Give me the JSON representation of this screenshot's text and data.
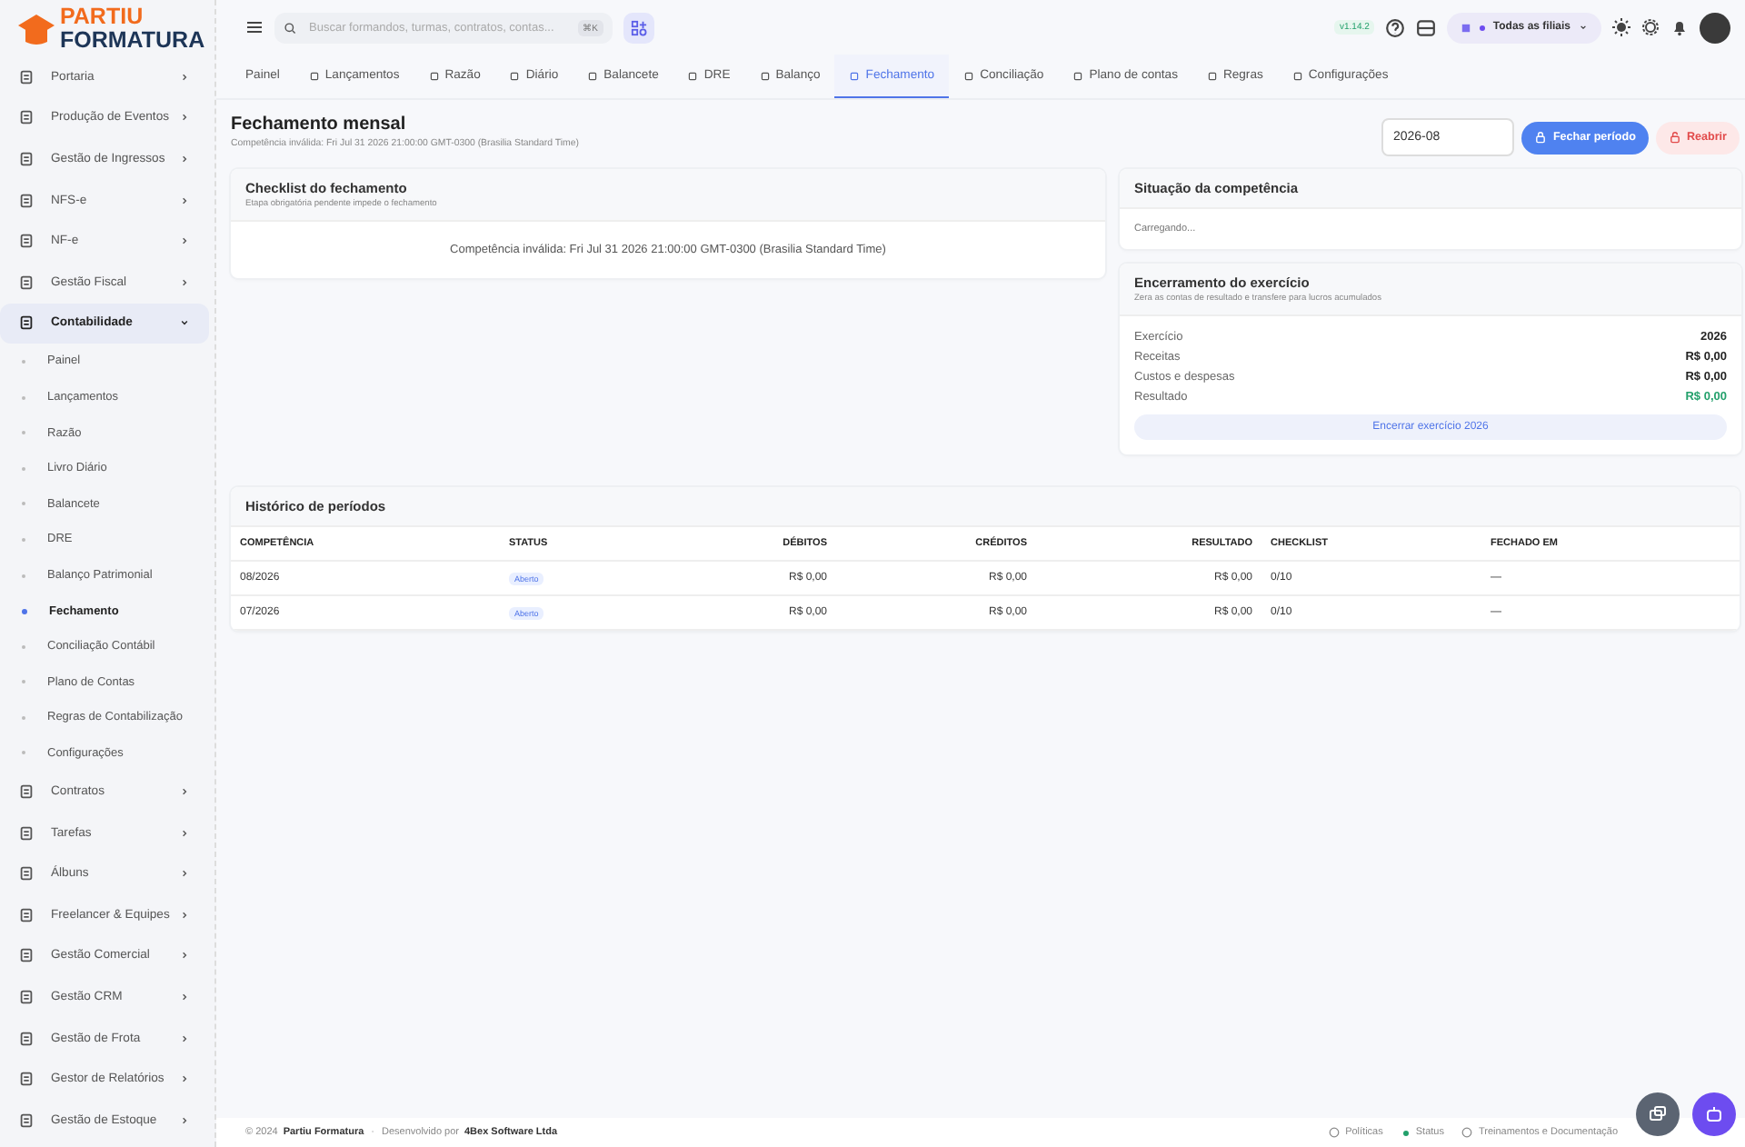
{
  "logo": {
    "line1": "PARTIU",
    "line2": "FORMATURA"
  },
  "sidebar": {
    "items": [
      {
        "label": "Portaria",
        "expanded": false,
        "selected": false
      },
      {
        "label": "Produção de Eventos",
        "expanded": false,
        "selected": false
      },
      {
        "label": "Gestão de Ingressos",
        "expanded": false,
        "selected": false
      },
      {
        "label": "NFS-e",
        "expanded": false,
        "selected": false
      },
      {
        "label": "NF-e",
        "expanded": false,
        "selected": false
      },
      {
        "label": "Gestão Fiscal",
        "expanded": false,
        "selected": false
      },
      {
        "label": "Contabilidade",
        "expanded": true,
        "selected": true,
        "children": [
          {
            "label": "Painel",
            "selected": false
          },
          {
            "label": "Lançamentos",
            "selected": false
          },
          {
            "label": "Razão",
            "selected": false
          },
          {
            "label": "Livro Diário",
            "selected": false
          },
          {
            "label": "Balancete",
            "selected": false
          },
          {
            "label": "DRE",
            "selected": false
          },
          {
            "label": "Balanço Patrimonial",
            "selected": false
          },
          {
            "label": "Fechamento",
            "selected": true
          },
          {
            "label": "Conciliação Contábil",
            "selected": false
          },
          {
            "label": "Plano de Contas",
            "selected": false
          },
          {
            "label": "Regras de Contabilização",
            "selected": false
          },
          {
            "label": "Configurações",
            "selected": false
          }
        ]
      },
      {
        "label": "Contratos",
        "expanded": false,
        "selected": false
      },
      {
        "label": "Tarefas",
        "expanded": false,
        "selected": false
      },
      {
        "label": "Álbuns",
        "expanded": false,
        "selected": false
      },
      {
        "label": "Freelancer & Equipes",
        "expanded": false,
        "selected": false
      },
      {
        "label": "Gestão Comercial",
        "expanded": false,
        "selected": false
      },
      {
        "label": "Gestão CRM",
        "expanded": false,
        "selected": false
      },
      {
        "label": "Gestão de Frota",
        "expanded": false,
        "selected": false
      },
      {
        "label": "Gestor de Relatórios",
        "expanded": false,
        "selected": false
      },
      {
        "label": "Gestão de Estoque",
        "expanded": false,
        "selected": false
      }
    ]
  },
  "topbar": {
    "search": {
      "placeholder": "Buscar formandos, turmas, contratos, contas...",
      "shortcut": "⌘K"
    },
    "version": "v1.14.2",
    "branch": "Todas as filiais"
  },
  "tabs": [
    {
      "label": "Painel",
      "selected": false
    },
    {
      "label": "Lançamentos",
      "selected": false
    },
    {
      "label": "Razão",
      "selected": false
    },
    {
      "label": "Diário",
      "selected": false
    },
    {
      "label": "Balancete",
      "selected": false
    },
    {
      "label": "DRE",
      "selected": false
    },
    {
      "label": "Balanço",
      "selected": false
    },
    {
      "label": "Fechamento",
      "selected": true
    },
    {
      "label": "Conciliação",
      "selected": false
    },
    {
      "label": "Plano de contas",
      "selected": false
    },
    {
      "label": "Regras",
      "selected": false
    },
    {
      "label": "Configurações",
      "selected": false
    }
  ],
  "page": {
    "title": "Fechamento mensal",
    "subtitle": "Competência inválida: Fri Jul 31 2026 21:00:00 GMT-0300 (Brasilia Standard Time)",
    "period": "2026-08",
    "close_button": "Fechar período",
    "reopen_button": "Reabrir"
  },
  "checklist": {
    "title": "Checklist do fechamento",
    "subtitle": "Etapa obrigatória pendente impede o fechamento",
    "message": "Competência inválida: Fri Jul 31 2026 21:00:00 GMT-0300 (Brasilia Standard Time)"
  },
  "situation": {
    "title": "Situação da competência",
    "message": "Carregando..."
  },
  "year_closing": {
    "title": "Encerramento do exercício",
    "subtitle": "Zera as contas de resultado e transfere para lucros acumulados",
    "rows": [
      {
        "label": "Exercício",
        "value": "2026",
        "kind": "plain"
      },
      {
        "label": "Receitas",
        "value": "R$ 0,00",
        "kind": "plain"
      },
      {
        "label": "Custos e despesas",
        "value": "R$ 0,00",
        "kind": "plain"
      },
      {
        "label": "Resultado",
        "value": "R$ 0,00",
        "kind": "positive"
      }
    ],
    "button": "Encerrar exercício 2026"
  },
  "history": {
    "title": "Histórico de períodos",
    "columns": [
      "COMPETÊNCIA",
      "STATUS",
      "DÉBITOS",
      "CRÉDITOS",
      "RESULTADO",
      "CHECKLIST",
      "FECHADO EM"
    ],
    "rows": [
      {
        "period": "08/2026",
        "status": "Aberto",
        "debits": "R$ 0,00",
        "credits": "R$ 0,00",
        "result": "R$ 0,00",
        "checklist": "0/10",
        "closed_at": "—"
      },
      {
        "period": "07/2026",
        "status": "Aberto",
        "debits": "R$ 0,00",
        "credits": "R$ 0,00",
        "result": "R$ 0,00",
        "checklist": "0/10",
        "closed_at": "—"
      }
    ]
  },
  "footer": {
    "copyright": "© 2024",
    "company": "Partiu Formatura",
    "separator": "·",
    "developed_by": "Desenvolvido por",
    "developer": "4Bex Software Ltda",
    "links": [
      "Políticas",
      "Status",
      "Treinamentos e Documentação"
    ]
  }
}
